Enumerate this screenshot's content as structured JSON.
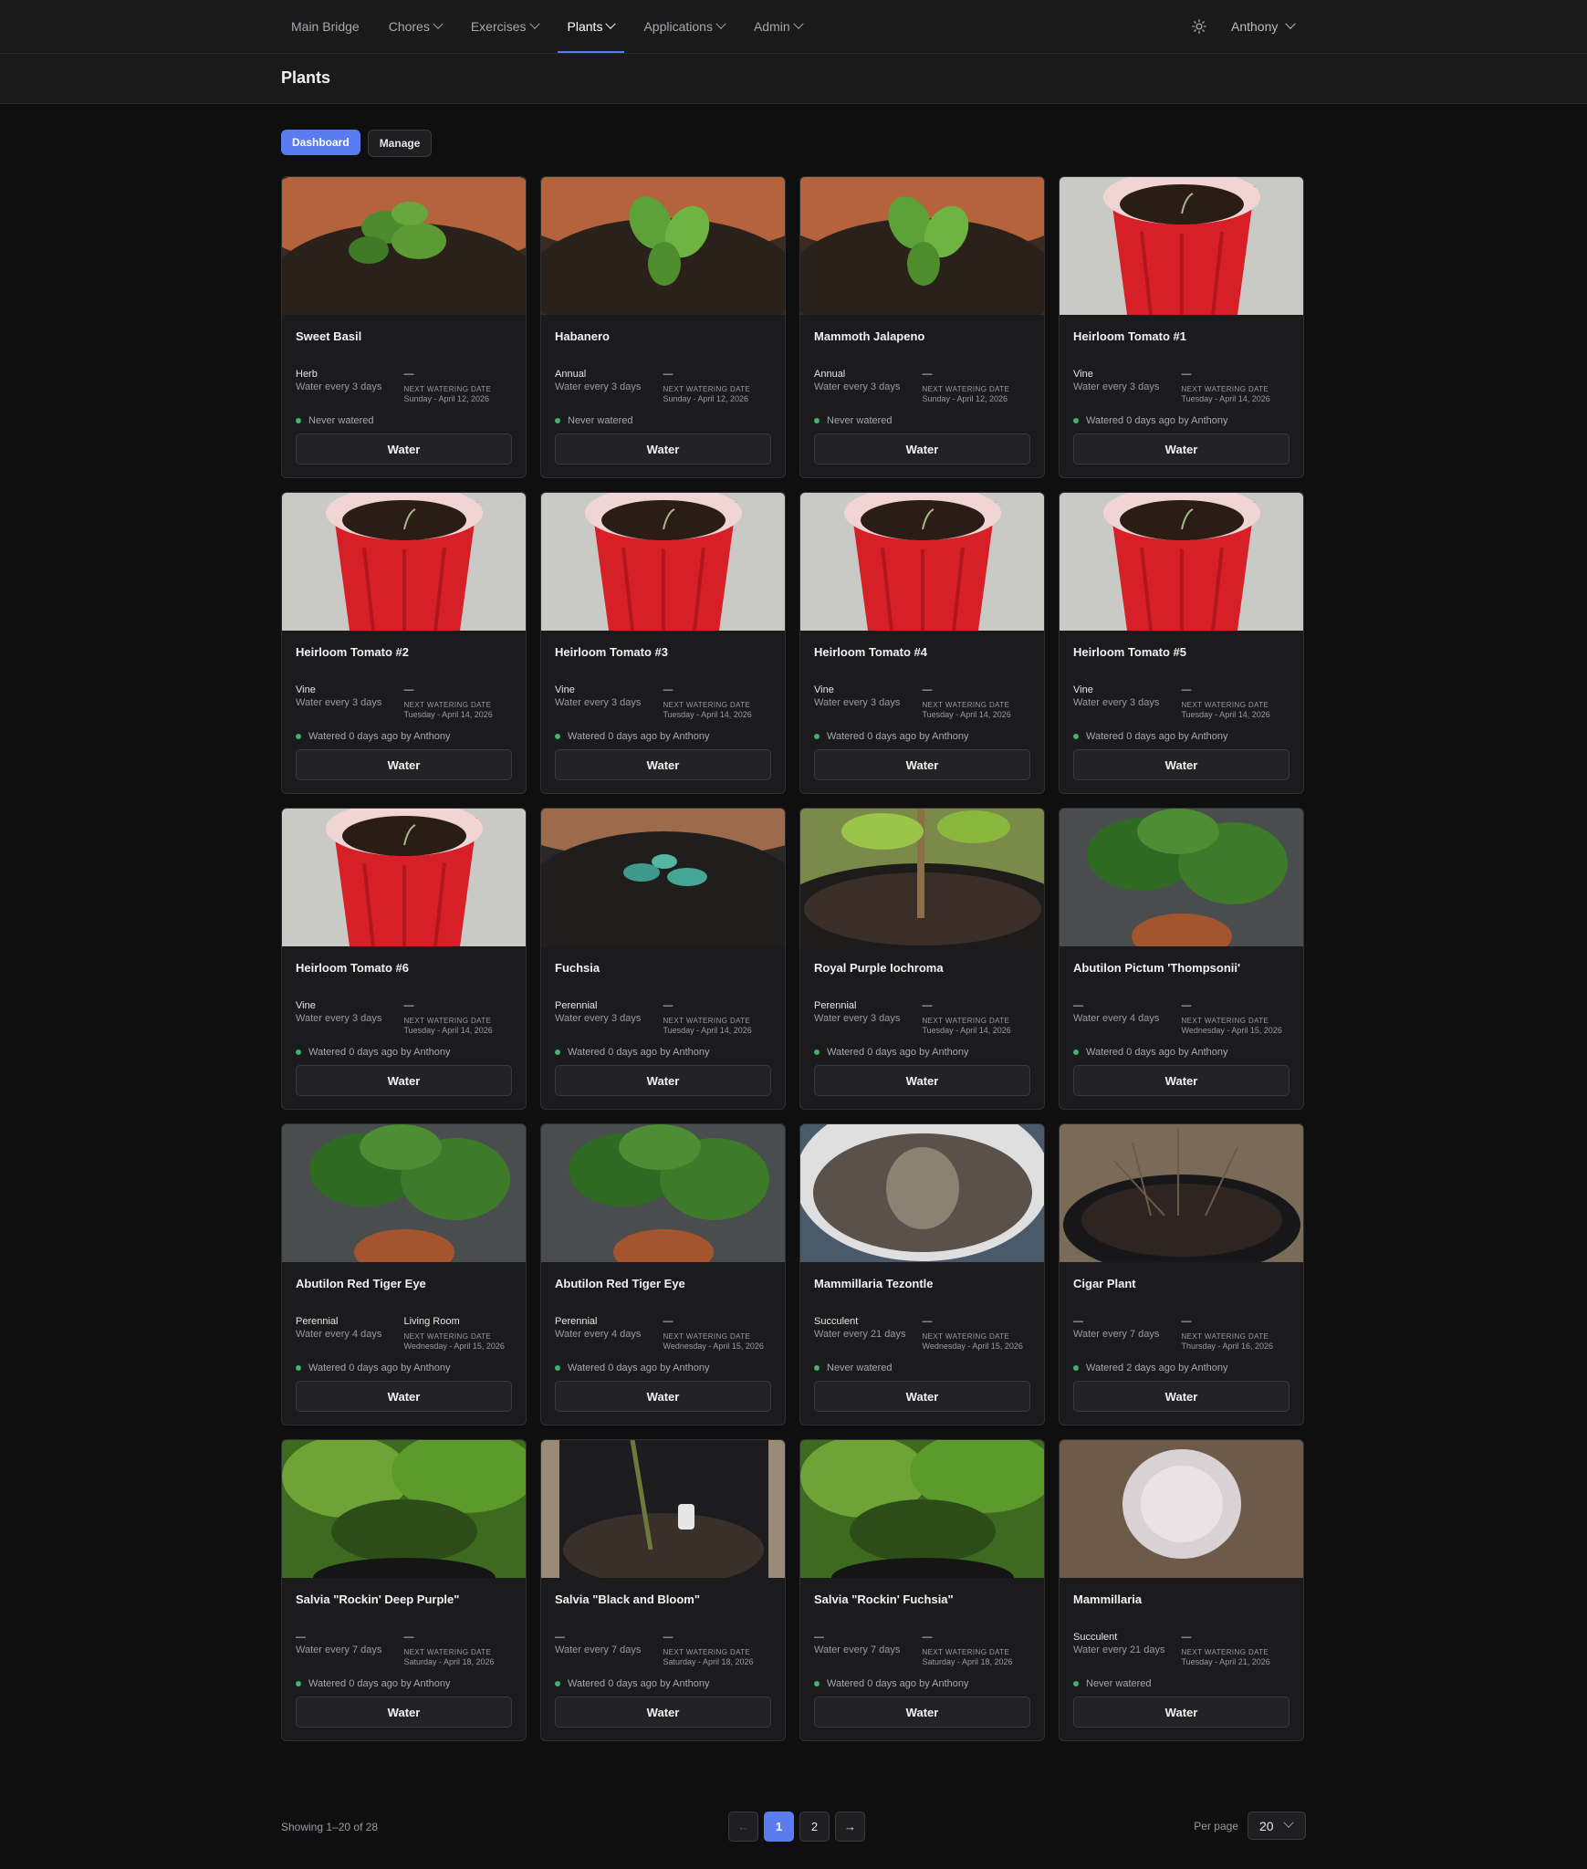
{
  "nav": {
    "items": [
      {
        "label": "Main Bridge",
        "dropdown": false,
        "active": false
      },
      {
        "label": "Chores",
        "dropdown": true,
        "active": false
      },
      {
        "label": "Exercises",
        "dropdown": true,
        "active": false
      },
      {
        "label": "Plants",
        "dropdown": true,
        "active": true
      },
      {
        "label": "Applications",
        "dropdown": true,
        "active": false
      },
      {
        "label": "Admin",
        "dropdown": true,
        "active": false
      }
    ],
    "theme_icon": "sun-icon",
    "user": "Anthony"
  },
  "page": {
    "title": "Plants"
  },
  "tabs": {
    "dashboard": "Dashboard",
    "manage": "Manage"
  },
  "labels": {
    "next_watering": "NEXT WATERING DATE",
    "water_button": "Water"
  },
  "plants": [
    {
      "name": "Sweet Basil",
      "type": "Herb",
      "frequency": "Water every 3 days",
      "location": "—",
      "next_date": "Sunday - April 12, 2026",
      "status": "Never watered",
      "photo": "basil"
    },
    {
      "name": "Habanero",
      "type": "Annual",
      "frequency": "Water every 3 days",
      "location": "—",
      "next_date": "Sunday - April 12, 2026",
      "status": "Never watered",
      "photo": "pepper"
    },
    {
      "name": "Mammoth Jalapeno",
      "type": "Annual",
      "frequency": "Water every 3 days",
      "location": "—",
      "next_date": "Sunday - April 12, 2026",
      "status": "Never watered",
      "photo": "pepper"
    },
    {
      "name": "Heirloom Tomato #1",
      "type": "Vine",
      "frequency": "Water every 3 days",
      "location": "—",
      "next_date": "Tuesday - April 14, 2026",
      "status": "Watered 0 days ago by Anthony",
      "photo": "cup"
    },
    {
      "name": "Heirloom Tomato #2",
      "type": "Vine",
      "frequency": "Water every 3 days",
      "location": "—",
      "next_date": "Tuesday - April 14, 2026",
      "status": "Watered 0 days ago by Anthony",
      "photo": "cup"
    },
    {
      "name": "Heirloom Tomato #3",
      "type": "Vine",
      "frequency": "Water every 3 days",
      "location": "—",
      "next_date": "Tuesday - April 14, 2026",
      "status": "Watered 0 days ago by Anthony",
      "photo": "cup"
    },
    {
      "name": "Heirloom Tomato #4",
      "type": "Vine",
      "frequency": "Water every 3 days",
      "location": "—",
      "next_date": "Tuesday - April 14, 2026",
      "status": "Watered 0 days ago by Anthony",
      "photo": "cup"
    },
    {
      "name": "Heirloom Tomato #5",
      "type": "Vine",
      "frequency": "Water every 3 days",
      "location": "—",
      "next_date": "Tuesday - April 14, 2026",
      "status": "Watered 0 days ago by Anthony",
      "photo": "cup"
    },
    {
      "name": "Heirloom Tomato #6",
      "type": "Vine",
      "frequency": "Water every 3 days",
      "location": "—",
      "next_date": "Tuesday - April 14, 2026",
      "status": "Watered 0 days ago by Anthony",
      "photo": "cup"
    },
    {
      "name": "Fuchsia",
      "type": "Perennial",
      "frequency": "Water every 3 days",
      "location": "—",
      "next_date": "Tuesday - April 14, 2026",
      "status": "Watered 0 days ago by Anthony",
      "photo": "soil"
    },
    {
      "name": "Royal Purple Iochroma",
      "type": "Perennial",
      "frequency": "Water every 3 days",
      "location": "—",
      "next_date": "Tuesday - April 14, 2026",
      "status": "Watered 0 days ago by Anthony",
      "photo": "shrub"
    },
    {
      "name": "Abutilon Pictum 'Thompsonii'",
      "type": "—",
      "frequency": "Water every 4 days",
      "location": "—",
      "next_date": "Wednesday - April 15, 2026",
      "status": "Watered 0 days ago by Anthony",
      "photo": "leafy"
    },
    {
      "name": "Abutilon Red Tiger Eye",
      "type": "Perennial",
      "frequency": "Water every 4 days",
      "location": "Living Room",
      "next_date": "Wednesday - April 15, 2026",
      "status": "Watered 0 days ago by Anthony",
      "photo": "leafy"
    },
    {
      "name": "Abutilon Red Tiger Eye",
      "type": "Perennial",
      "frequency": "Water every 4 days",
      "location": "—",
      "next_date": "Wednesday - April 15, 2026",
      "status": "Watered 0 days ago by Anthony",
      "photo": "leafy"
    },
    {
      "name": "Mammillaria Tezontle",
      "type": "Succulent",
      "frequency": "Water every 21 days",
      "location": "—",
      "next_date": "Wednesday - April 15, 2026",
      "status": "Never watered",
      "photo": "cactus"
    },
    {
      "name": "Cigar Plant",
      "type": "—",
      "frequency": "Water every 7 days",
      "location": "—",
      "next_date": "Thursday - April 16, 2026",
      "status": "Watered 2 days ago by Anthony",
      "photo": "twigs"
    },
    {
      "name": "Salvia \"Rockin' Deep Purple\"",
      "type": "—",
      "frequency": "Water every 7 days",
      "location": "—",
      "next_date": "Saturday - April 18, 2026",
      "status": "Watered 0 days ago by Anthony",
      "photo": "garden"
    },
    {
      "name": "Salvia \"Black and Bloom\"",
      "type": "—",
      "frequency": "Water every 7 days",
      "location": "—",
      "next_date": "Saturday - April 18, 2026",
      "status": "Watered 0 days ago by Anthony",
      "photo": "blackpot"
    },
    {
      "name": "Salvia \"Rockin' Fuchsia\"",
      "type": "—",
      "frequency": "Water every 7 days",
      "location": "—",
      "next_date": "Saturday - April 18, 2026",
      "status": "Watered 0 days ago by Anthony",
      "photo": "garden"
    },
    {
      "name": "Mammillaria",
      "type": "Succulent",
      "frequency": "Water every 21 days",
      "location": "—",
      "next_date": "Tuesday - April 21, 2026",
      "status": "Never watered",
      "photo": "fuzzy"
    }
  ],
  "pagination": {
    "showing": "Showing 1–20 of 28",
    "prev": "←",
    "next": "→",
    "pages": [
      "1",
      "2"
    ],
    "current": "1",
    "per_page_label": "Per page",
    "per_page": "20"
  },
  "colors": {
    "accent": "#5b7cf0",
    "status_dot": "#3db36b",
    "background": "#0f0f10",
    "card": "#1b1b1d"
  }
}
